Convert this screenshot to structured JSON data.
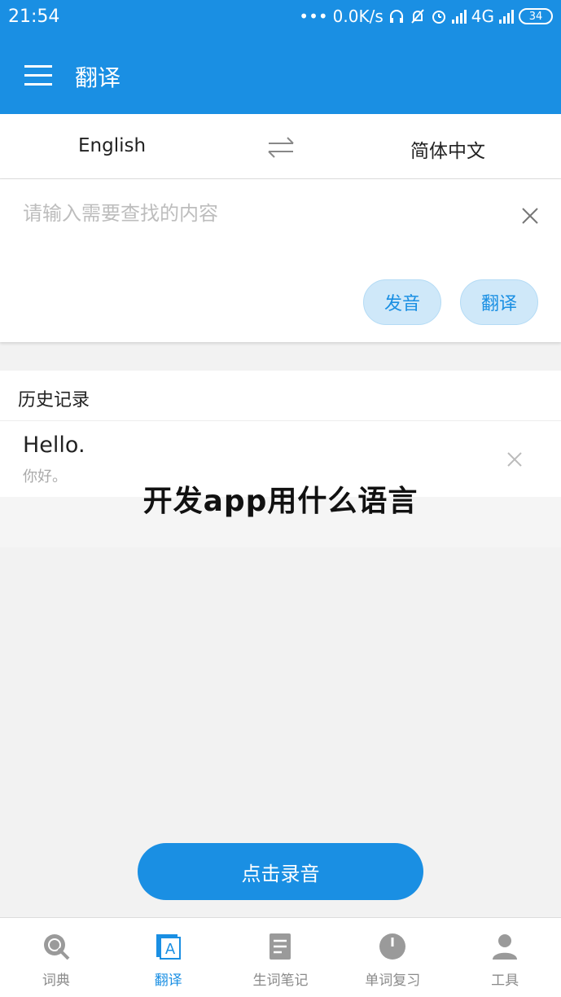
{
  "status_bar": {
    "time": "21:54",
    "dots": "•••",
    "speed": "0.0K/s",
    "network": "4G",
    "battery": "34"
  },
  "app_bar": {
    "title": "翻译"
  },
  "languages": {
    "source": "English",
    "target": "简体中文"
  },
  "input": {
    "placeholder": "请输入需要查找的内容",
    "value": ""
  },
  "actions": {
    "speak": "发音",
    "translate": "翻译"
  },
  "history": {
    "title": "历史记录",
    "items": [
      {
        "word": "Hello.",
        "translation": "你好。"
      }
    ]
  },
  "overlay_caption": "开发app用什么语言",
  "record_button": "点击录音",
  "bottom_nav": {
    "items": [
      {
        "label": "词典",
        "icon": "dictionary-search-icon",
        "active": false
      },
      {
        "label": "翻译",
        "icon": "translate-icon",
        "active": true
      },
      {
        "label": "生词笔记",
        "icon": "notebook-icon",
        "active": false
      },
      {
        "label": "单词复习",
        "icon": "clock-icon",
        "active": false
      },
      {
        "label": "工具",
        "icon": "user-tools-icon",
        "active": false
      }
    ]
  },
  "colors": {
    "primary": "#1a8fe3",
    "pill_bg": "#cfe8f9",
    "nav_inactive": "#8a8a8a"
  }
}
